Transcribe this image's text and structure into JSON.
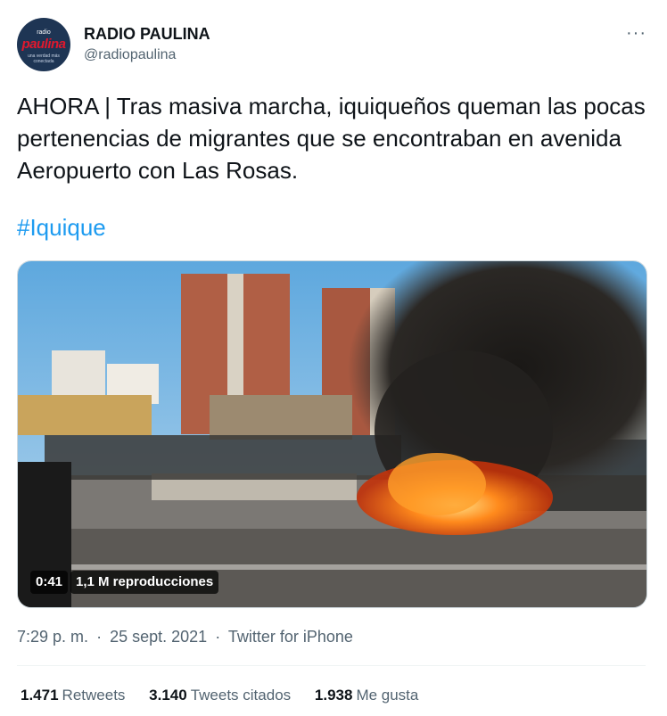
{
  "account": {
    "display_name": "RADIO PAULINA",
    "handle": "@radiopaulina",
    "avatar_small": "radio",
    "avatar_brand": "paulina",
    "avatar_tagline": "una verdad más conectada"
  },
  "more_icon": "···",
  "tweet": {
    "text": "AHORA | Tras masiva marcha, iquiqueños queman las pocas pertenencias de migrantes que se encontraban en avenida Aeropuerto con Las Rosas.",
    "hashtag": "#Iquique"
  },
  "video": {
    "duration": "0:41",
    "views": "1,1 M reproducciones"
  },
  "meta": {
    "time": "7:29 p. m.",
    "separator": "·",
    "date": "25 sept. 2021",
    "source": "Twitter for iPhone"
  },
  "stats": [
    {
      "count": "1.471",
      "label": "Retweets"
    },
    {
      "count": "3.140",
      "label": "Tweets citados"
    },
    {
      "count": "1.938",
      "label": "Me gusta"
    }
  ],
  "colors": {
    "link": "#1d9bf0",
    "secondary": "#536471",
    "avatar_bg": "#1e3554",
    "avatar_brand": "#e0182d"
  }
}
